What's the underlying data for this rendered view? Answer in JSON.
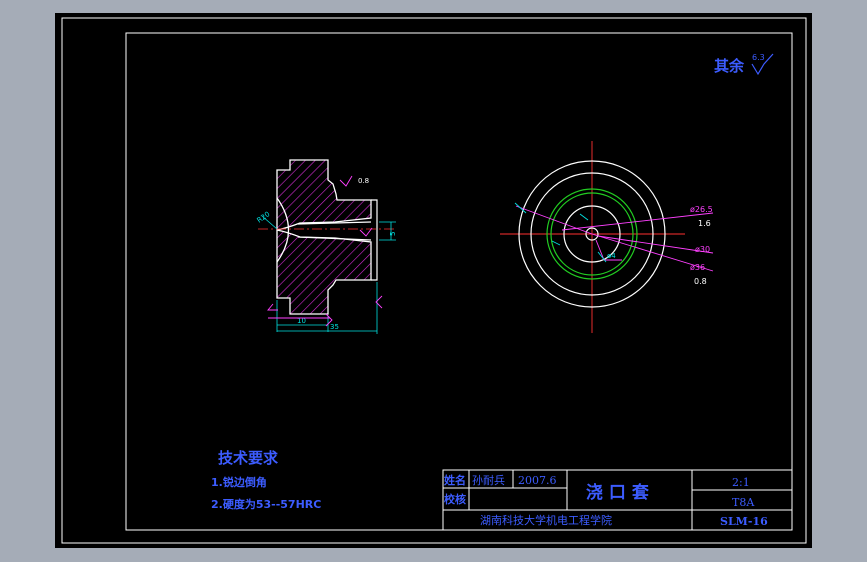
{
  "colors": {
    "window_bg": "#a5acb7",
    "paper": "#000000",
    "frame": "#ffffff",
    "blue_text": "#3c5cff",
    "part_outline": "#ffffff",
    "hatch": "#d22cd2",
    "dimension": "#00e0e0",
    "center_line": "#ff3030",
    "green_circle": "#22cc22",
    "leader": "#ff40ff"
  },
  "surface_note": {
    "label": "其余",
    "roughness": "6.3"
  },
  "section_view": {
    "dims": {
      "radius": "R20",
      "roughness_top": "0.8",
      "diameter_right": "5",
      "length_inner": "10",
      "length_outer": "35"
    }
  },
  "top_view": {
    "callouts": [
      {
        "value": "ø26.5",
        "sub": "1.6"
      },
      {
        "value": "ø30",
        "sub": ""
      },
      {
        "value": "ø36",
        "sub": "0.8"
      }
    ],
    "center_label": "ø4"
  },
  "tech_requirements": {
    "title": "技术要求",
    "items": [
      "1.锐边倒角",
      "2.硬度为53--57HRC"
    ]
  },
  "title_block": {
    "row1_label": "姓名",
    "row2_label": "校核",
    "designer": "孙耐兵",
    "date": "2007.6",
    "part_name": "浇 口 套",
    "scale": "2:1",
    "material": "T8A",
    "school": "湖南科技大学机电工程学院",
    "drawing_no": "SLM-16"
  }
}
